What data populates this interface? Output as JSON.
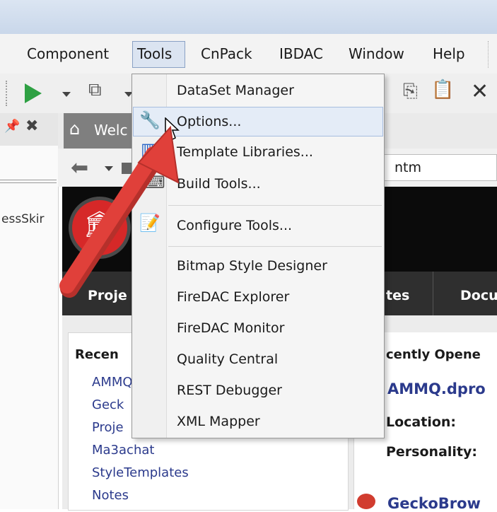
{
  "menubar": {
    "items": [
      {
        "label": "Component"
      },
      {
        "label": "Tools"
      },
      {
        "label": "CnPack"
      },
      {
        "label": "IBDAC"
      },
      {
        "label": "Window"
      },
      {
        "label": "Help"
      }
    ]
  },
  "tools_menu": {
    "items": [
      {
        "label": "DataSet Manager",
        "icon": "none"
      },
      {
        "label": "Options...",
        "icon": "wrench-icon"
      },
      {
        "label": "Template Libraries...",
        "icon": "libraries-icon"
      },
      {
        "label": "Build Tools...",
        "icon": "build-tools-icon"
      },
      {
        "label": "Configure Tools...",
        "icon": "configure-tools-icon"
      },
      {
        "label": "Bitmap Style Designer",
        "icon": "none"
      },
      {
        "label": "FireDAC Explorer",
        "icon": "none"
      },
      {
        "label": "FireDAC Monitor",
        "icon": "none"
      },
      {
        "label": "Quality Central",
        "icon": "none"
      },
      {
        "label": "REST Debugger",
        "icon": "none"
      },
      {
        "label": "XML Mapper",
        "icon": "none"
      }
    ],
    "hovered": "Options..."
  },
  "left_dock": {
    "text": "essSkir"
  },
  "welcome_tab": {
    "label": "Welc"
  },
  "browser": {
    "url_fragment": "ntm"
  },
  "page_nav": {
    "items": [
      "Proje",
      "tes",
      "Docu"
    ]
  },
  "recent_panel": {
    "title": "Recen",
    "items": [
      "AMMQ",
      "Geck",
      "Proje",
      "Ma3achat",
      "StyleTemplates",
      "Notes"
    ]
  },
  "opened_panel": {
    "title": "cently Opene",
    "file": "AMMQ.dpro",
    "location_label": "Location:",
    "personality_label": "Personality:",
    "file2": "GeckoBrow"
  },
  "colors": {
    "run_green": "#2ea043",
    "annotation_red": "#e0403a",
    "menu_highlight": "#e4ecf7",
    "banner_black": "#0b0b0b",
    "link_blue": "#2b3a8c"
  }
}
